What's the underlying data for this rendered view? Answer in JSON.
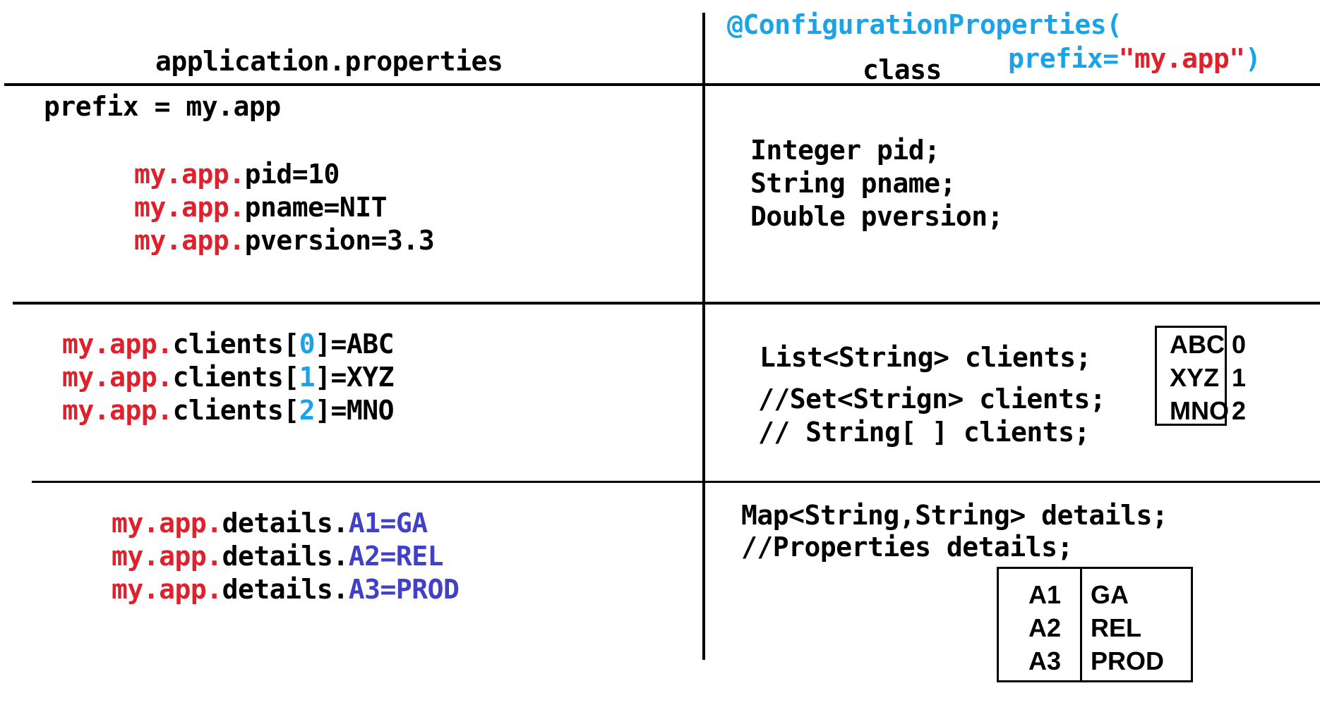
{
  "header": {
    "left_title": "application.properties",
    "annotation_line1": "@ConfigurationProperties(",
    "annotation_prefix_key": "prefix=",
    "annotation_prefix_value": "\"my.app\"",
    "annotation_close": ")",
    "right_title": "class"
  },
  "section1": {
    "prefix_line": "prefix = my.app",
    "properties": [
      {
        "prefix": "my.app.",
        "rest": "pid=10"
      },
      {
        "prefix": "my.app.",
        "rest": "pname=NIT"
      },
      {
        "prefix": "my.app.",
        "rest": "pversion=3.3"
      }
    ],
    "fields": [
      "Integer pid;",
      "String pname;",
      "Double pversion;"
    ]
  },
  "section2": {
    "properties": [
      {
        "prefix": "my.app.",
        "key": "clients[",
        "index": "0",
        "value": "]=ABC"
      },
      {
        "prefix": "my.app.",
        "key": "clients[",
        "index": "1",
        "value": "]=XYZ"
      },
      {
        "prefix": "my.app.",
        "key": "clients[",
        "index": "2",
        "value": "]=MNO"
      }
    ],
    "fields": [
      "List<String> clients;",
      "//Set<Strign> clients;",
      "// String[ ] clients;"
    ],
    "list_table": {
      "values": [
        "ABC",
        "XYZ",
        "MNO"
      ],
      "indexes": [
        "0",
        "1",
        "2"
      ]
    }
  },
  "section3": {
    "properties": [
      {
        "prefix": "my.app.",
        "key": "details.",
        "entry": "A1=GA"
      },
      {
        "prefix": "my.app.",
        "key": "details.",
        "entry": "A2=REL"
      },
      {
        "prefix": "my.app.",
        "key": "details.",
        "entry": "A3=PROD"
      }
    ],
    "fields": [
      "Map<String,String> details;",
      "//Properties details;"
    ],
    "map_table": {
      "keys": [
        "A1",
        "A2",
        "A3"
      ],
      "values": [
        "GA",
        "REL",
        "PROD"
      ]
    }
  },
  "colors": {
    "prefix_red": "#e0202b",
    "annotation_cyan": "#1aa3e8",
    "entry_blue": "#4040c8",
    "lines": "#000000"
  }
}
